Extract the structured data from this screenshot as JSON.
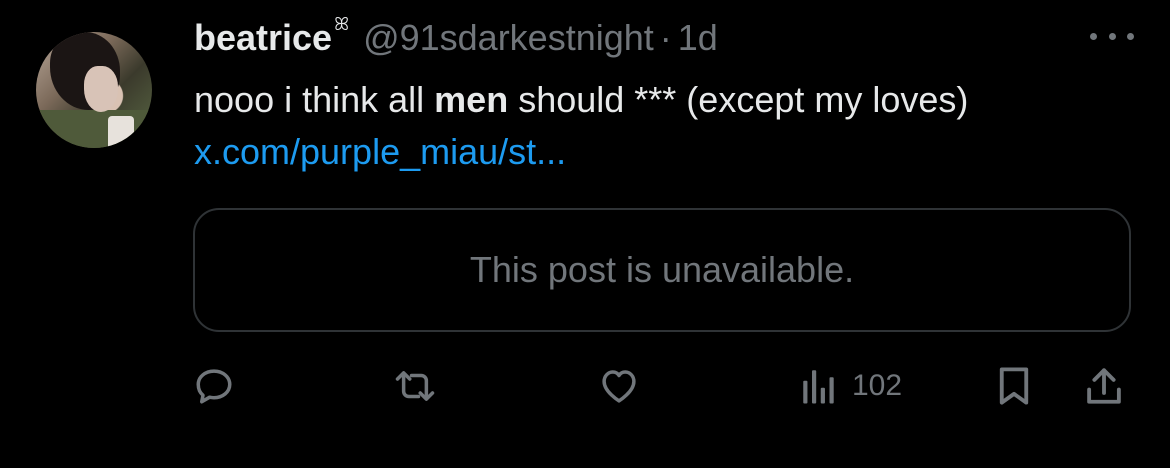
{
  "author": {
    "name": "beatrice",
    "badge": "ꕤ",
    "handle": "@91sdarkestnight",
    "separator": "·",
    "time": "1d"
  },
  "post": {
    "text_part1": "nooo i think all ",
    "text_bold": "men",
    "text_part2": " should *** (except my loves) ",
    "link_text": "x.com/purple_miau/st..."
  },
  "quote_card": {
    "text": "This post is unavailable."
  },
  "actions": {
    "views_count": "102"
  },
  "colors": {
    "background": "#000000",
    "primary_text": "#e7e9ea",
    "secondary_text": "#71767b",
    "link": "#1d9bf0",
    "border": "#2f3336"
  },
  "icons": [
    "more-icon",
    "reply-icon",
    "repost-icon",
    "like-icon",
    "views-icon",
    "bookmark-icon",
    "share-icon"
  ]
}
